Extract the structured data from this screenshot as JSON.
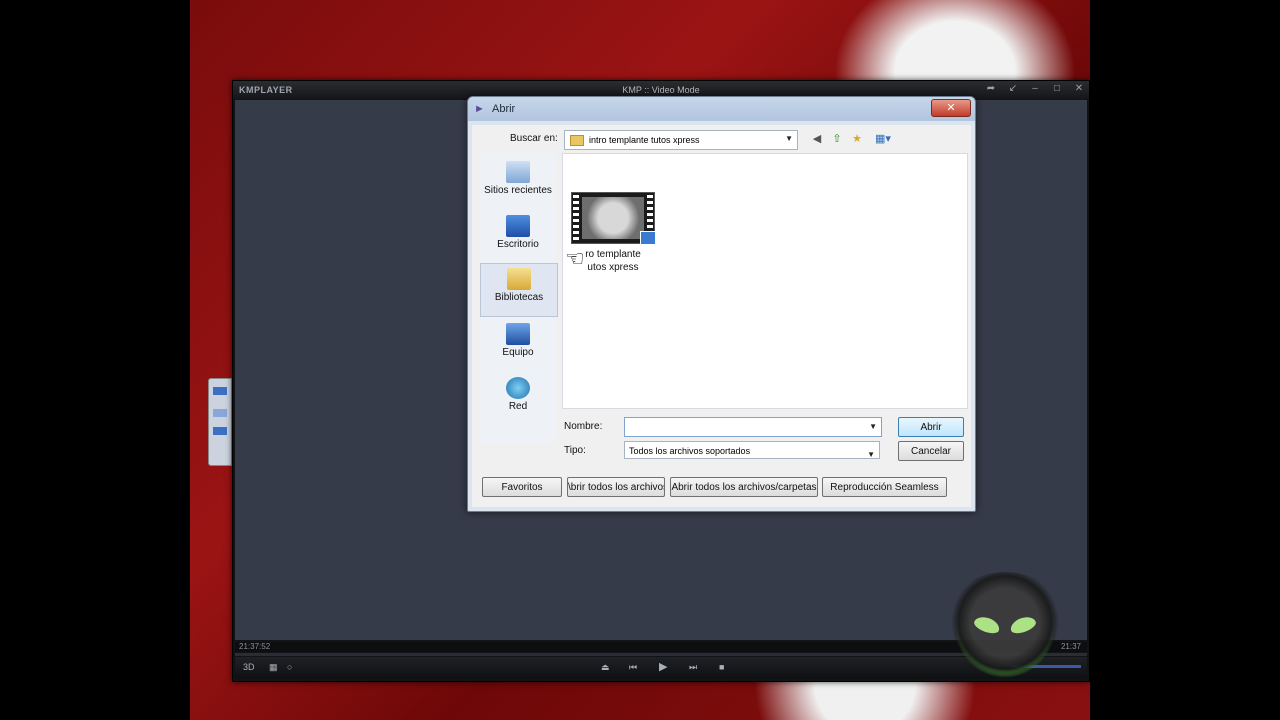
{
  "player": {
    "logo": "KMPLAYER",
    "title": "KMP :: Video Mode",
    "window_buttons": [
      "➦",
      "↙",
      "–",
      "□",
      "✕"
    ],
    "time_current": "21:37:52",
    "time_end": "21:37",
    "controls": {
      "left": [
        "3D",
        "▦",
        "○"
      ],
      "center": [
        "⏏",
        "⏮",
        "▶",
        "⏭",
        "■"
      ]
    }
  },
  "dialog": {
    "title": "Abrir",
    "close_label": "✕",
    "look_in_label": "Buscar en:",
    "look_in_value": "intro templante tutos xpress",
    "toolbar_icons": [
      "back-icon",
      "up-folder-icon",
      "new-folder-icon",
      "view-menu-icon"
    ],
    "places": [
      {
        "label": "Sitios recientes",
        "icon": "recent-places-icon"
      },
      {
        "label": "Escritorio",
        "icon": "desktop-icon"
      },
      {
        "label": "Bibliotecas",
        "icon": "libraries-icon"
      },
      {
        "label": "Equipo",
        "icon": "computer-icon"
      },
      {
        "label": "Red",
        "icon": "network-icon"
      }
    ],
    "file": {
      "name_line1": "ro templante",
      "name_line2": "utos xpress"
    },
    "name_label": "Nombre:",
    "name_value": "",
    "type_label": "Tipo:",
    "type_value": "Todos los archivos soportados",
    "open_button": "Abrir",
    "cancel_button": "Cancelar",
    "bottom_buttons": {
      "favorites": "Favoritos",
      "open_all_files": "\\brir todos los archivos",
      "open_all_files_folders": "Abrir todos los archivos/carpetas",
      "seamless": "Reproducción Seamless"
    }
  },
  "colors": {
    "player_bg": "#363b4a",
    "desktop_red": "#9b1414",
    "dialog_frame": "#dbe4ef",
    "accent_blue": "#3c7fb1"
  }
}
